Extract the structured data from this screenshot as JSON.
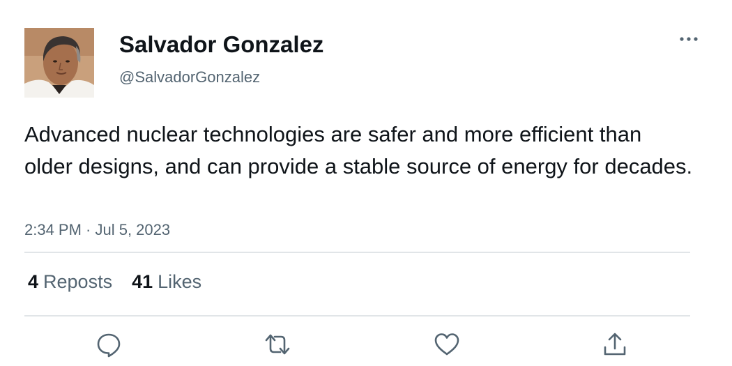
{
  "tweet": {
    "author": {
      "display_name": "Salvador Gonzalez",
      "handle": "@SalvadorGonzalez",
      "avatar_icon": "profile-photo"
    },
    "text": "Advanced nuclear technologies are safer and more efficient than older designs, and can provide a stable source of energy for decades.",
    "timestamp": "2:34 PM · Jul 5, 2023",
    "stats": {
      "reposts_count": "4",
      "reposts_label": "Reposts",
      "likes_count": "41",
      "likes_label": "Likes"
    },
    "actions": [
      "reply-icon",
      "repost-icon",
      "like-icon",
      "share-icon"
    ],
    "menu_icon": "more-options-icon"
  },
  "colors": {
    "text_primary": "#0f1419",
    "text_secondary": "#536471",
    "divider": "#e1e5e8"
  }
}
